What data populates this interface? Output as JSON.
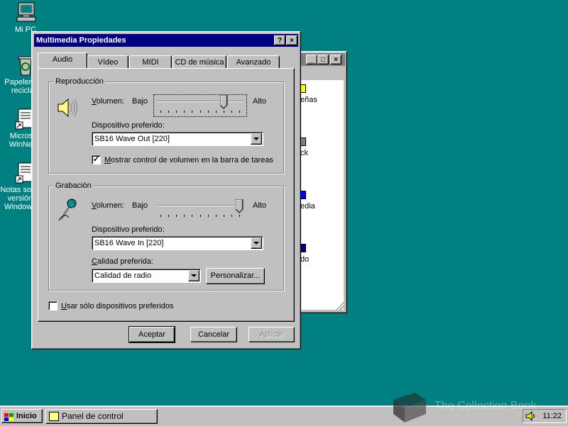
{
  "desktop": {
    "icons": [
      {
        "label": "Mi PC"
      },
      {
        "label": "Papelera de reciclaje"
      },
      {
        "label": "Microsoft WinNews"
      },
      {
        "label": "Notas sobre la versión de Windows 95"
      }
    ]
  },
  "background_window": {
    "items": [
      "eñas",
      "ck",
      "edia",
      "do"
    ]
  },
  "dialog": {
    "title": "Multimedia Propiedades",
    "help_button": "?",
    "close_button": "×",
    "tabs": [
      {
        "label": "Audio",
        "active": true
      },
      {
        "label": "Vídeo",
        "active": false
      },
      {
        "label": "MIDI",
        "active": false
      },
      {
        "label": "CD de música",
        "active": false
      },
      {
        "label": "Avanzado",
        "active": false
      }
    ],
    "playback": {
      "group_label": "Reproducción",
      "volume_label": "Volumen:",
      "low_label": "Bajo",
      "high_label": "Alto",
      "volume_level": 0.8,
      "device_label": "Dispositivo preferido:",
      "device_value": "SB16 Wave Out [220]",
      "show_volume_checkbox_label": "Mostrar control de volumen en la barra de tareas",
      "show_volume_checked": true
    },
    "recording": {
      "group_label": "Grabación",
      "volume_label": "Volumen:",
      "low_label": "Bajo",
      "high_label": "Alto",
      "volume_level": 1.0,
      "device_label": "Dispositivo preferido:",
      "device_value": "SB16 Wave In [220]",
      "quality_label": "Calidad preferida:",
      "quality_value": "Calidad de radio",
      "customize_button": "Personalizar..."
    },
    "use_preferred_label": "Usar sólo dispositivos preferidos",
    "use_preferred_checked": false,
    "buttons": {
      "ok": "Aceptar",
      "cancel": "Cancelar",
      "apply": "Aplicar"
    }
  },
  "taskbar": {
    "start_label": "Inicio",
    "task_label": "Panel de control",
    "clock": "11:22"
  },
  "watermark": "The Collection Book",
  "colors": {
    "desktop": "#008080",
    "title_active": "#000080",
    "title_inactive": "#808080",
    "face": "#c0c0c0"
  }
}
